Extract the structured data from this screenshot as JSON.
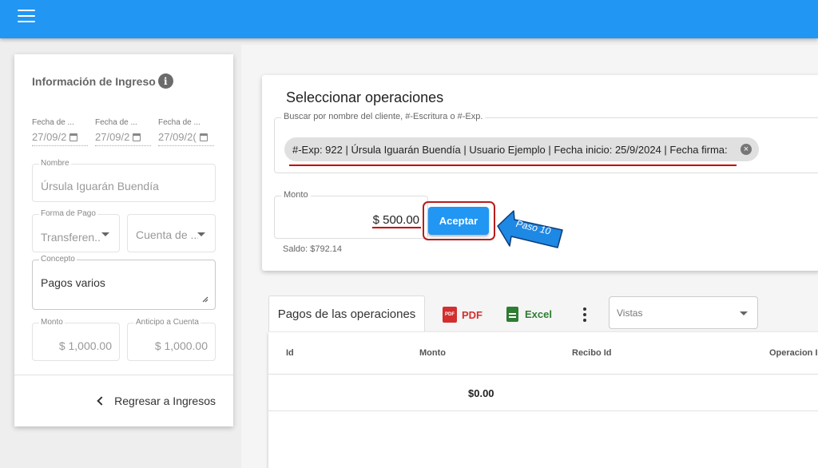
{
  "left_panel": {
    "title": "Información de Ingreso",
    "info_icon": "i",
    "dates": [
      {
        "label": "Fecha de ...",
        "value": "27/09/2"
      },
      {
        "label": "Fecha de ...",
        "value": "27/09/2"
      },
      {
        "label": "Fecha de ...",
        "value": "27/09/2("
      }
    ],
    "nombre_label": "Nombre",
    "nombre_value": "Úrsula  Iguarán  Buendía",
    "forma_pago_label": "Forma de Pago",
    "forma_pago_value": "Transferen...",
    "cuenta_value": "Cuenta de ...",
    "concepto_label": "Concepto",
    "concepto_value": "Pagos varios",
    "monto_label": "Monto",
    "monto_value": "$ 1,000.00",
    "anticipo_label": "Anticipo a Cuenta",
    "anticipo_value": "$ 1,000.00",
    "back_label": "Regresar a Ingresos"
  },
  "operaciones": {
    "title": "Seleccionar operaciones",
    "search_label": "Buscar por nombre del cliente, #-Escritura o #-Exp.",
    "chip_text": "#-Exp: 922 | Úrsula Iguarán Buendía | Usuario Ejemplo | Fecha inicio: 25/9/2024 | Fecha firma:",
    "monto_label": "Monto",
    "monto_value": "$ 500.00",
    "saldo": "Saldo: $792.14",
    "aceptar_label": "Aceptar",
    "annotation": "Paso 10"
  },
  "pagos": {
    "tab_label": "Pagos de las operaciones",
    "pdf_label": "PDF",
    "pdf_icon_text": "PDF",
    "excel_label": "Excel",
    "vistas_label": "Vistas",
    "columns": [
      "Id",
      "Monto",
      "Recibo Id",
      "Operacion Id"
    ],
    "total": "$0.00"
  },
  "colors": {
    "primary": "#2196f3",
    "annotation_red": "#c00000",
    "pdf_red": "#d32f2f",
    "excel_green": "#2e7d32"
  },
  "icons": [
    "menu-icon",
    "info-icon",
    "calendar-icon",
    "resize-icon",
    "chevron-left-icon",
    "clear-icon",
    "pdf-icon",
    "excel-icon",
    "more-vert-icon",
    "dropdown-caret-icon"
  ]
}
